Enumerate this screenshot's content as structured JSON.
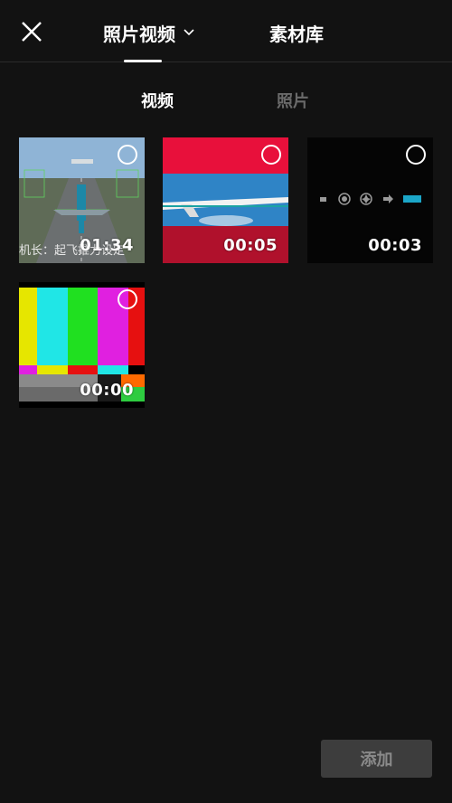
{
  "header": {
    "close_icon": "close-icon",
    "tab_photos_videos": "照片视频",
    "tab_library": "素材库"
  },
  "subtabs": {
    "videos": "视频",
    "photos": "照片"
  },
  "media": [
    {
      "duration": "01:34",
      "caption": "机长：起飞推力设定"
    },
    {
      "duration": "00:05"
    },
    {
      "duration": "00:03"
    },
    {
      "duration": "00:00"
    }
  ],
  "footer": {
    "add_label": "添加"
  },
  "colors": {
    "background": "#121212",
    "add_button_bg": "#3d3d3d",
    "inactive_text": "#6a6a6a"
  }
}
